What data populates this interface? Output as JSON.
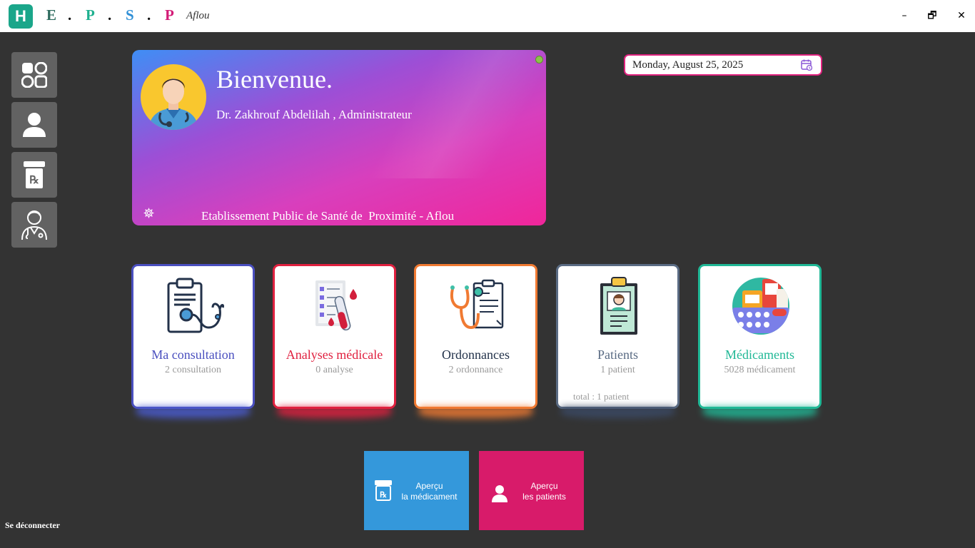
{
  "titlebar": {
    "logo_letter": "H",
    "brand": [
      {
        "letter": "E",
        "color": "#2e6b5e"
      },
      {
        "letter": "P",
        "color": "#1fb08f"
      },
      {
        "letter": "S",
        "color": "#2f8fd6"
      },
      {
        "letter": "P",
        "color": "#d31c77"
      }
    ],
    "dot": ".",
    "city": "Aflou",
    "minimize": "–",
    "restore": "🗗",
    "close": "✕"
  },
  "sidebar": {
    "items": [
      {
        "name": "dashboard"
      },
      {
        "name": "patients"
      },
      {
        "name": "medicaments"
      },
      {
        "name": "doctor"
      }
    ],
    "logout_label": "Se déconnecter"
  },
  "welcome": {
    "title": "Bienvenue.",
    "user": "Dr. Zakhrouf Abdelilah , Administrateur",
    "establishment": "Etablissement Public de Santé de  Proximité - Aflou",
    "status_color": "#8bc34a"
  },
  "date": {
    "value": "Monday, August 25, 2025"
  },
  "cards": [
    {
      "title": "Ma consultation",
      "subtitle": "2 consultation",
      "color": "#4a4fbf"
    },
    {
      "title": "Analyses médicale",
      "subtitle": "0 analyse",
      "color": "#e0203f"
    },
    {
      "title": "Ordonnances",
      "subtitle": "2 ordonnance",
      "color": "#22324a",
      "border": "#f07a32"
    },
    {
      "title": "Patients",
      "subtitle": "1 patient",
      "total": "total : 1 patient",
      "color": "#5a6b83"
    },
    {
      "title": "Médicaments",
      "subtitle": "5028 médicament",
      "color": "#20b896"
    }
  ],
  "tiles": [
    {
      "line1": "Aperçu",
      "line2": "la médicament",
      "color": "#3498db"
    },
    {
      "line1": "Aperçu",
      "line2": "les patients",
      "color": "#d81b6a"
    }
  ]
}
